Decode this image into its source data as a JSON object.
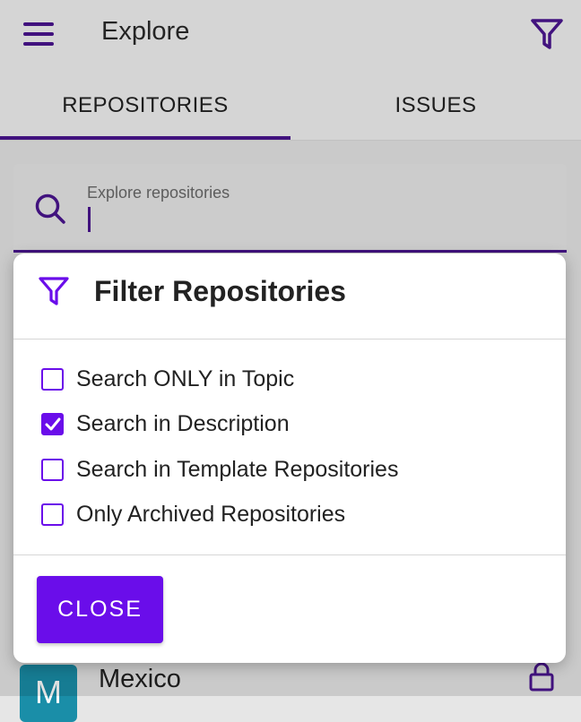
{
  "appbar": {
    "title": "Explore",
    "menu_icon": "hamburger-menu-icon",
    "filter_icon": "filter-funnel-icon"
  },
  "tabs": [
    {
      "label": "REPOSITORIES",
      "selected": true
    },
    {
      "label": "ISSUES",
      "selected": false
    }
  ],
  "search": {
    "label": "Explore repositories",
    "value": "",
    "icon": "search-icon"
  },
  "list": {
    "items": [
      {
        "avatar_letter": "M",
        "title": "Mexico",
        "icon": "lock-icon"
      }
    ]
  },
  "dialog": {
    "title": "Filter Repositories",
    "icon": "filter-funnel-icon",
    "options": [
      {
        "label": "Search ONLY in Topic",
        "checked": false
      },
      {
        "label": "Search in Description",
        "checked": true
      },
      {
        "label": "Search in Template Repositories",
        "checked": false
      },
      {
        "label": "Only Archived Repositories",
        "checked": false
      }
    ],
    "close_label": "CLOSE"
  },
  "colors": {
    "primary": "#6a0dea",
    "primary_dark": "#4b1590",
    "avatar_bg": "#1a8ea8"
  }
}
